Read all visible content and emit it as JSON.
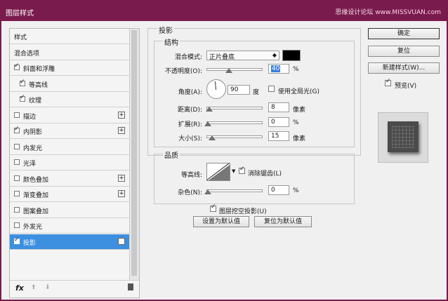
{
  "window": {
    "title": "图层样式",
    "watermark": "思缘设计论坛",
    "watermark_url": "www.MISSVUAN.com"
  },
  "styles_list": {
    "items": [
      {
        "label": "样式",
        "checkbox": false,
        "checked": false,
        "indent": false,
        "plus": false,
        "selected": false
      },
      {
        "label": "混合选项",
        "checkbox": false,
        "checked": false,
        "indent": false,
        "plus": false,
        "selected": false
      },
      {
        "label": "斜面和浮雕",
        "checkbox": true,
        "checked": true,
        "indent": false,
        "plus": false,
        "selected": false
      },
      {
        "label": "等高线",
        "checkbox": true,
        "checked": true,
        "indent": true,
        "plus": false,
        "selected": false
      },
      {
        "label": "纹理",
        "checkbox": true,
        "checked": true,
        "indent": true,
        "plus": false,
        "selected": false
      },
      {
        "label": "描边",
        "checkbox": true,
        "checked": false,
        "indent": false,
        "plus": true,
        "selected": false
      },
      {
        "label": "内阴影",
        "checkbox": true,
        "checked": true,
        "indent": false,
        "plus": true,
        "selected": false
      },
      {
        "label": "内发光",
        "checkbox": true,
        "checked": false,
        "indent": false,
        "plus": false,
        "selected": false
      },
      {
        "label": "光泽",
        "checkbox": true,
        "checked": false,
        "indent": false,
        "plus": false,
        "selected": false
      },
      {
        "label": "颜色叠加",
        "checkbox": true,
        "checked": false,
        "indent": false,
        "plus": true,
        "selected": false
      },
      {
        "label": "渐变叠加",
        "checkbox": true,
        "checked": false,
        "indent": false,
        "plus": true,
        "selected": false
      },
      {
        "label": "图案叠加",
        "checkbox": true,
        "checked": false,
        "indent": false,
        "plus": false,
        "selected": false
      },
      {
        "label": "外发光",
        "checkbox": true,
        "checked": false,
        "indent": false,
        "plus": false,
        "selected": false
      },
      {
        "label": "投影",
        "checkbox": true,
        "checked": true,
        "indent": false,
        "plus": true,
        "selected": true
      }
    ],
    "footer": {
      "fx": "fx",
      "up": "⬆",
      "down": "⬇"
    }
  },
  "drop_shadow": {
    "section_title": "投影",
    "structure": {
      "title": "结构",
      "blend_mode_label": "混合模式:",
      "blend_mode_value": "正片叠底",
      "shadow_color": "#000000",
      "opacity_label": "不透明度(O):",
      "opacity_value": "40",
      "opacity_unit": "%",
      "opacity_level": 40,
      "angle_label": "角度(A):",
      "angle_value": "90",
      "angle_unit": "度",
      "global_light_label": "使用全局光(G)",
      "global_light_checked": false,
      "distance_label": "距离(D):",
      "distance_value": "8",
      "distance_unit": "像素",
      "spread_label": "扩展(R):",
      "spread_value": "0",
      "spread_unit": "%",
      "size_label": "大小(S):",
      "size_value": "15",
      "size_unit": "像素"
    },
    "quality": {
      "title": "品质",
      "contour_label": "等高线:",
      "antialias_label": "消除锯齿(L)",
      "antialias_checked": true,
      "noise_label": "杂色(N):",
      "noise_value": "0",
      "noise_unit": "%"
    },
    "knockout_label": "图层挖空投影(U)",
    "knockout_checked": true,
    "make_default_label": "设置为默认值",
    "reset_default_label": "复位为默认值"
  },
  "buttons": {
    "ok": "确定",
    "reset": "复位",
    "new_style": "新建样式(W)...",
    "preview_label": "预览(V)",
    "preview_checked": true
  }
}
